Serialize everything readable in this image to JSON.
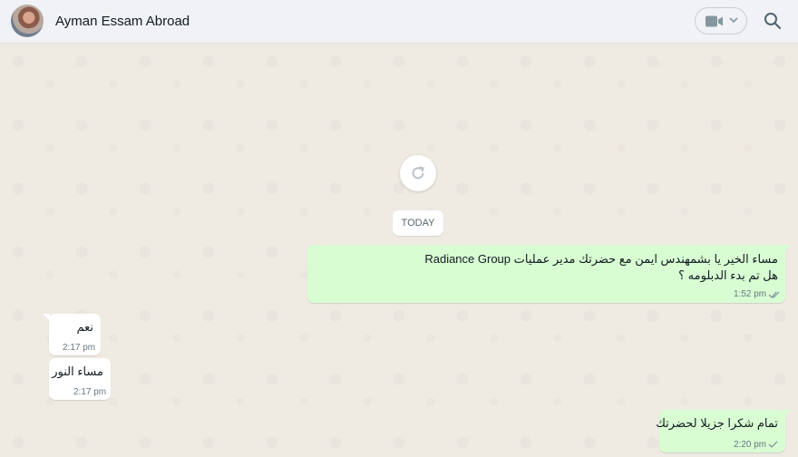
{
  "header": {
    "contact_name": "Ayman Essam Abroad",
    "avatar_icon": "avatar-photo",
    "video_icon": "video-camera-icon",
    "search_icon": "search-icon"
  },
  "chat": {
    "refresh_icon": "refresh-icon",
    "date_label": "TODAY",
    "messages": [
      {
        "direction": "outgoing",
        "lines": [
          "مساء الخير يا بشمهندس ايمن مع حضرتك مدير عمليات Radiance Group",
          "هل تم بدء الدبلومه ؟"
        ],
        "time": "1:52 pm",
        "status": "read"
      },
      {
        "direction": "incoming",
        "lines": [
          "نعم"
        ],
        "time": "2:17 pm"
      },
      {
        "direction": "incoming",
        "lines": [
          "مساء النور"
        ],
        "time": "2:17 pm"
      },
      {
        "direction": "outgoing",
        "lines": [
          "تمام شكرا جزيلا لحضرتك"
        ],
        "time": "2:20 pm",
        "status": "sent"
      }
    ]
  },
  "colors": {
    "outgoing_bubble": "#d9fdd3",
    "incoming_bubble": "#ffffff",
    "chat_background": "#efeae2",
    "header_background": "#f0f2f5",
    "read_tick": "#8696a0"
  }
}
